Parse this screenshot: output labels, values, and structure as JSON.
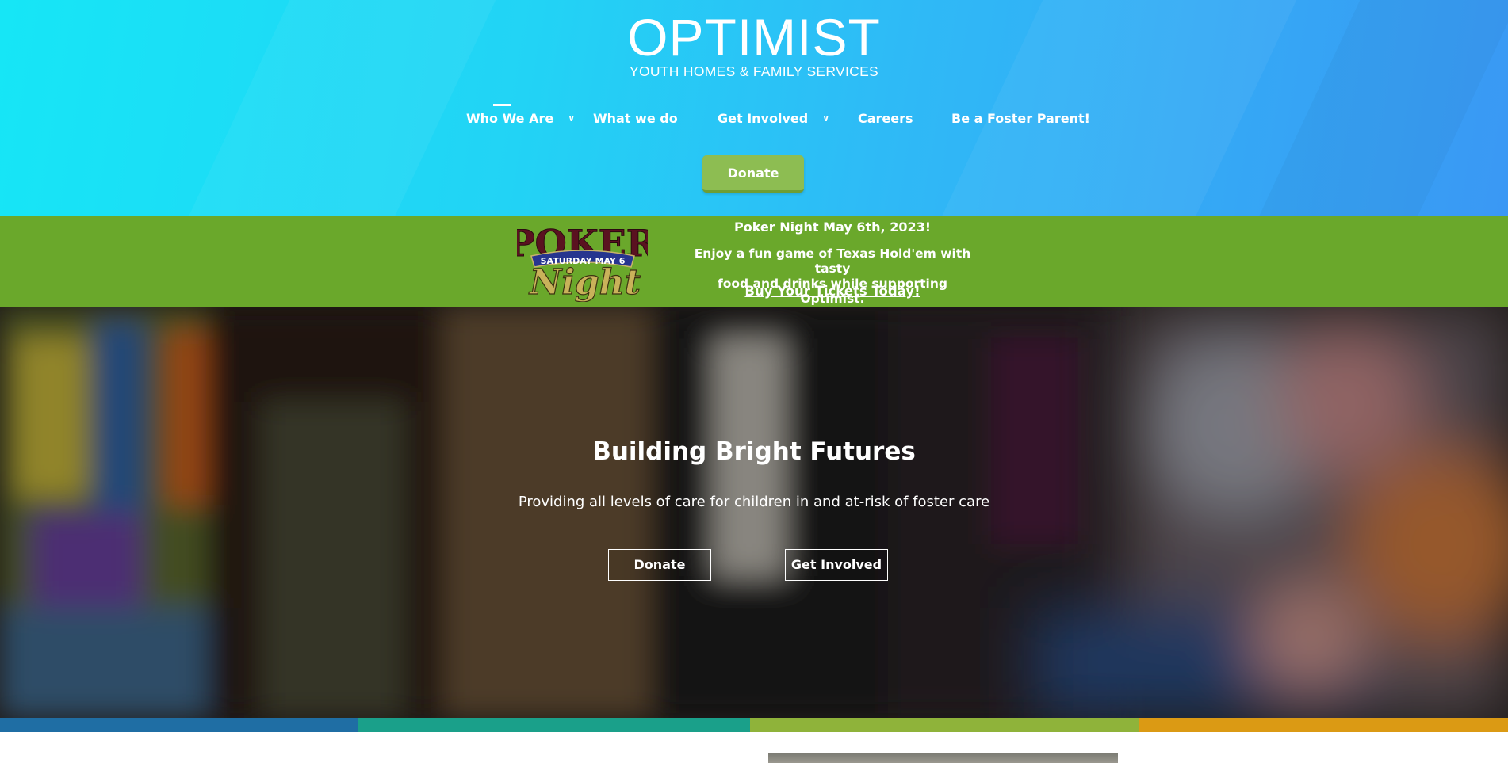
{
  "header": {
    "logo_main": "OPTIMIST",
    "logo_sub": "YOUTH HOMES & FAMILY SERVICES",
    "nav": [
      {
        "label": "Who We Are",
        "has_dropdown": true,
        "active": true
      },
      {
        "label": "What we do",
        "has_dropdown": false
      },
      {
        "label": "Get Involved",
        "has_dropdown": true
      },
      {
        "label": "Careers",
        "has_dropdown": false
      },
      {
        "label": "Be a Foster Parent!",
        "has_dropdown": false
      }
    ],
    "donate_label": "Donate"
  },
  "promo": {
    "logo_word_top": "POKER",
    "logo_ribbon": "SATURDAY MAY 6",
    "logo_word_bottom": "Night",
    "title": "Poker Night May 6th, 2023!",
    "body_line1": "Enjoy a fun game of Texas Hold'em with tasty",
    "body_line2": "food and drinks while supporting Optimist.",
    "link": "Buy Your Tickets Today!",
    "background": "#6aa82b"
  },
  "hero": {
    "title": "Building Bright Futures",
    "subtitle": "Providing all levels of care for children in and at-risk of foster care",
    "btn_donate": "Donate",
    "btn_involved": "Get Involved"
  },
  "colors": {
    "header_start": "#16e6f6",
    "header_end": "#3a98f4",
    "donate_green": "#8dbd52",
    "stripe_blue": "#1f6ea4",
    "stripe_teal": "#1aa08a",
    "stripe_green": "#8fb33a",
    "stripe_gold": "#db9a14"
  }
}
